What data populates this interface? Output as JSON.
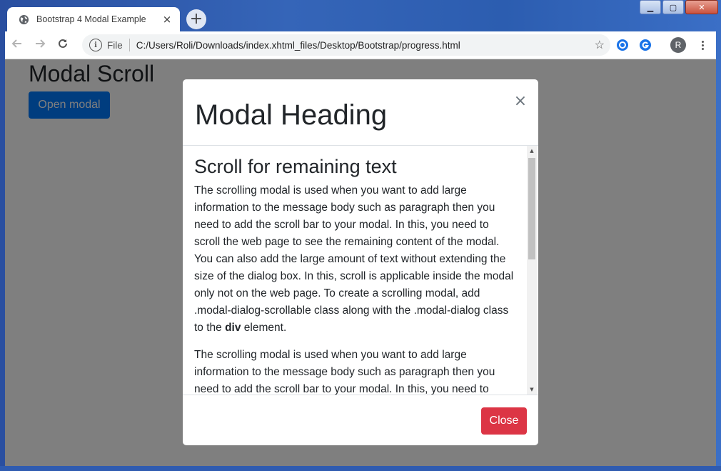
{
  "browser": {
    "tab_title": "Bootstrap 4 Modal Example",
    "tab_close": "×",
    "new_tab": "+",
    "address_label": "File",
    "address_url": "C:/Users/Roli/Downloads/index.xhtml_files/Desktop/Bootstrap/progress.html",
    "profile_initial": "R",
    "window_controls": {
      "minimize": "▁",
      "maximize": "▢",
      "close": "✕"
    }
  },
  "page": {
    "title": "Modal Scroll",
    "open_button": "Open modal"
  },
  "modal": {
    "heading": "Modal Heading",
    "close_x": "×",
    "body_heading": "Scroll for remaining text",
    "paragraph_1": "The scrolling modal is used when you want to add large information to the message body such as paragraph then you need to add the scroll bar to your modal. In this, you need to scroll the web page to see the remaining content of the modal. You can also add the large amount of text without extending the size of the dialog box. In this, scroll is applicable inside the modal only not on the web page. To create a scrolling modal, add .modal-dialog-scrollable class along with the .modal-dialog class to the ",
    "paragraph_1_bold": "div",
    "paragraph_1_end": " element.",
    "paragraph_2": "The scrolling modal is used when you want to add large information to the message body such as paragraph then you need to add the scroll bar to your modal. In this, you need to scroll the web page to see the remaining content of the modal.",
    "close_button": "Close"
  },
  "colors": {
    "primary": "#007bff",
    "danger": "#dc3545",
    "backdrop": "rgba(0,0,0,0.5)"
  },
  "icons": {
    "tab_favicon": "globe-icon",
    "back": "arrow-left-icon",
    "forward": "arrow-right-icon",
    "reload": "reload-icon",
    "info": "info-icon",
    "bookmark": "star-icon"
  }
}
